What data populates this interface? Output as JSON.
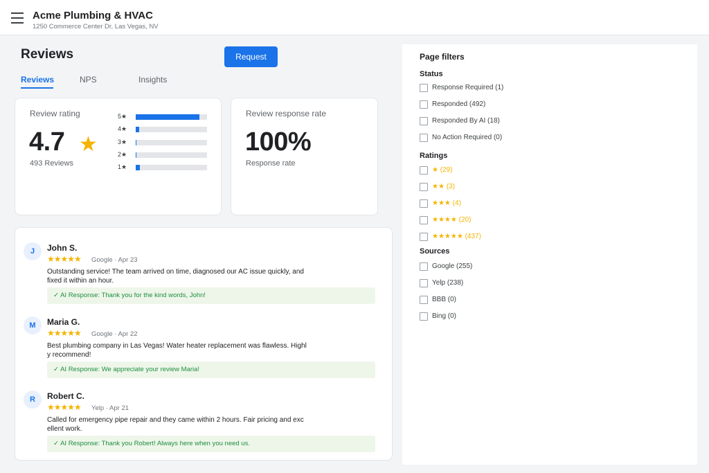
{
  "header": {
    "business_name": "Acme Plumbing & HVAC",
    "address": "1250 Commerce Center Dr, Las Vegas, NV"
  },
  "page": {
    "title": "Reviews",
    "request_label": "Request",
    "tabs": [
      {
        "label": "Reviews",
        "active": true
      },
      {
        "label": "NPS",
        "active": false
      },
      {
        "label": "Insights",
        "active": false
      }
    ]
  },
  "rating_card": {
    "label": "Review rating",
    "value": "4.7",
    "star": "★",
    "count_text": "493 Reviews",
    "distribution": [
      {
        "label": "5★",
        "fraction": 0.89
      },
      {
        "label": "4★",
        "fraction": 0.05
      },
      {
        "label": "3★",
        "fraction": 0.01
      },
      {
        "label": "2★",
        "fraction": 0.01
      },
      {
        "label": "1★",
        "fraction": 0.06
      }
    ]
  },
  "response_card": {
    "label": "Review response rate",
    "value": "100%",
    "sub": "Response rate"
  },
  "reviews": [
    {
      "initial": "J",
      "name": "John S.",
      "stars": "★★★★★",
      "meta": "Google · Apr 23",
      "text": "Outstanding service! The team arrived on time, diagnosed our AC issue quickly, and fixed it within an hour.",
      "ai_response": "✓ AI Response: Thank you for the kind words, John!"
    },
    {
      "initial": "M",
      "name": "Maria G.",
      "stars": "★★★★★",
      "meta": "Google · Apr 22",
      "text": "Best plumbing company in Las Vegas! Water heater replacement was flawless. Highly recommend!",
      "ai_response": "✓ AI Response: We appreciate your review Maria!"
    },
    {
      "initial": "R",
      "name": "Robert C.",
      "stars": "★★★★★",
      "meta": "Yelp · Apr 21",
      "text": "Called for emergency pipe repair and they came within 2 hours. Fair pricing and excellent work.",
      "ai_response": "✓ AI Response: Thank you Robert! Always here when you need us."
    }
  ],
  "filters": {
    "title": "Page filters",
    "status_title": "Status",
    "status": [
      "Response Required (1)",
      "Responded (492)",
      "Responded By AI (18)",
      "No Action Required (0)"
    ],
    "ratings_title": "Ratings",
    "ratings": [
      "★ (29)",
      "★★ (3)",
      "★★★ (4)",
      "★★★★ (20)",
      "★★★★★ (437)"
    ],
    "sources_title": "Sources",
    "sources": [
      "Google (255)",
      "Yelp (238)",
      "BBB (0)",
      "Bing (0)"
    ]
  },
  "colors": {
    "accent": "#1a73e8",
    "star": "#f4b400",
    "ai_green": "#1e8e3e"
  }
}
